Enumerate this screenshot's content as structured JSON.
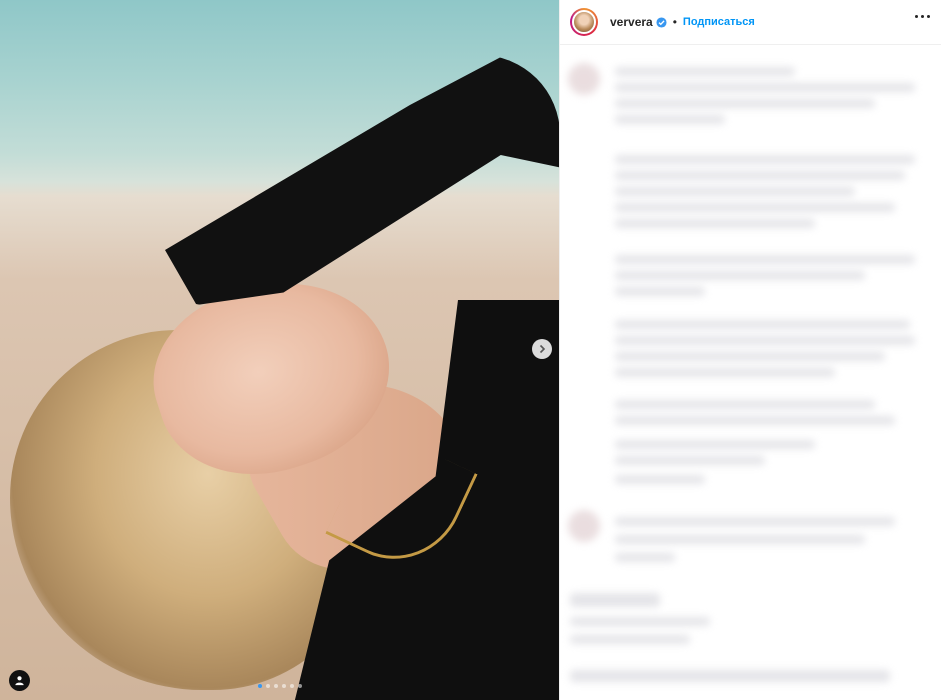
{
  "header": {
    "username": "ververa",
    "separator": "•",
    "follow_label": "Подписаться"
  },
  "carousel": {
    "total_slides": 6,
    "active_slide": 1
  },
  "colors": {
    "accent": "#0095f6",
    "verified": "#3897f0",
    "text": "#262626"
  },
  "icons": [
    "verified-badge-icon",
    "more-options-icon",
    "next-arrow-icon",
    "user-tag-icon"
  ]
}
